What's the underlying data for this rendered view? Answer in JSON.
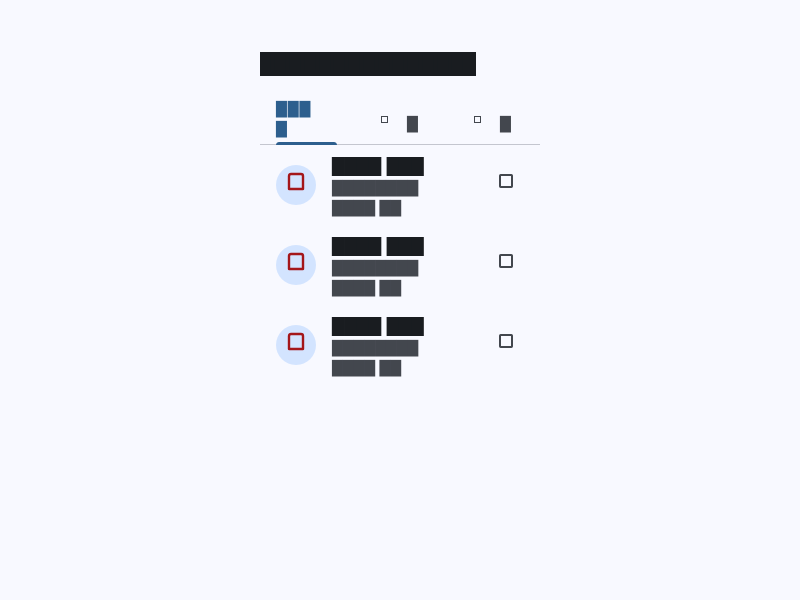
{
  "app": {
    "title": "██████████████"
  },
  "tabs": [
    {
      "label": "████",
      "icon": "square-outline-icon"
    },
    {
      "label": "█",
      "icon": "square-outline-icon"
    },
    {
      "label": "█",
      "icon": "square-outline-icon"
    }
  ],
  "list": {
    "items": [
      {
        "title": "████ ███",
        "line1": "████████",
        "line2": "████ ██",
        "avatar_icon": "folder-icon",
        "action_icon": "checkbox-outline-icon"
      },
      {
        "title": "████ ███",
        "line1": "████████",
        "line2": "████ ██",
        "avatar_icon": "folder-icon",
        "action_icon": "checkbox-outline-icon"
      },
      {
        "title": "████ ███",
        "line1": "████████",
        "line2": "████ ██",
        "avatar_icon": "folder-icon",
        "action_icon": "checkbox-outline-icon"
      }
    ]
  },
  "colors": {
    "background": "#f8f9ff",
    "primary": "#2d5f8e",
    "on_surface": "#191c20",
    "on_surface_variant": "#43474e",
    "avatar_bg": "#d3e4ff",
    "avatar_icon": "#a4161a",
    "divider": "#c4c6cf"
  }
}
